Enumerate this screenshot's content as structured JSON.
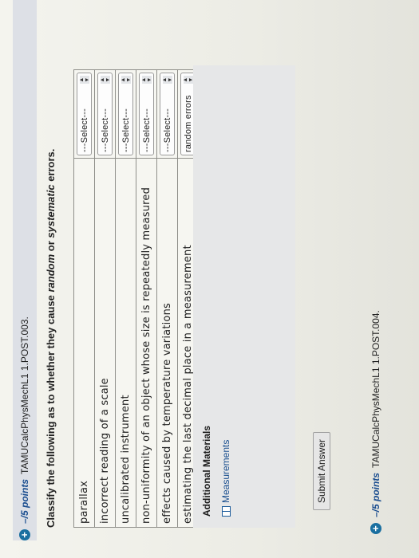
{
  "question": {
    "points": "–/5 points",
    "id": "TAMUCalcPhysMechL1 1.POST.003.",
    "prompt_before": "Classify the following as to whether they cause ",
    "prompt_word1": "random",
    "prompt_mid": " or ",
    "prompt_word2": "systematic",
    "prompt_after": " errors."
  },
  "rows": [
    {
      "label": "parallax",
      "select": "---Select---"
    },
    {
      "label": "incorrect reading of a scale",
      "select": "---Select---"
    },
    {
      "label": "uncalibrated instrument",
      "select": "---Select---"
    },
    {
      "label": "non-uniformity of an object whose size is repeatedly measured",
      "select": "---Select---"
    },
    {
      "label": "effects caused by temperature variations",
      "select": "---Select---"
    },
    {
      "label": "estimating the last decimal place in a measurement",
      "select": "random errors"
    }
  ],
  "additional": {
    "title": "Additional Materials",
    "link": "Measurements"
  },
  "submit_label": "Submit Answer",
  "next_question": {
    "points": "–/5 points",
    "id": "TAMUCalcPhysMechL1 1.POST.004."
  }
}
